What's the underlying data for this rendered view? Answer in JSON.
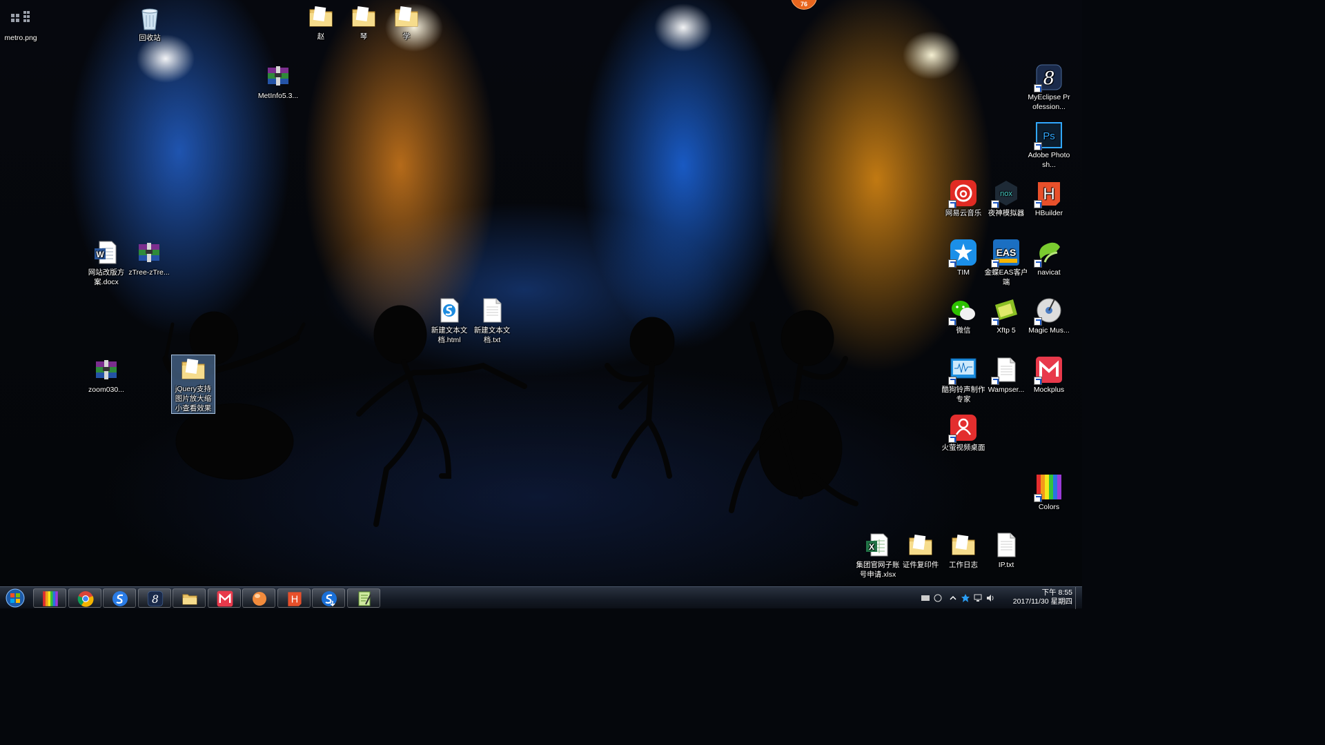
{
  "notification_badge": "76",
  "desktop_icons": [
    {
      "id": "metro-png",
      "label": "metro.png",
      "icon": "image-file-icon"
    },
    {
      "id": "recycle-bin",
      "label": "回收站",
      "icon": "recycle-bin-icon"
    },
    {
      "id": "folder-zhao",
      "label": "赵",
      "icon": "folder-icon"
    },
    {
      "id": "folder-qin",
      "label": "琴",
      "icon": "folder-icon"
    },
    {
      "id": "folder-xue",
      "label": "学",
      "icon": "folder-icon"
    },
    {
      "id": "metinfo",
      "label": "MetInfo5.3...",
      "icon": "winrar-archive-icon"
    },
    {
      "id": "website-docx",
      "label": "网站改版方案.docx",
      "icon": "word-document-icon"
    },
    {
      "id": "ztree",
      "label": "zTree-zTre...",
      "icon": "winrar-archive-icon"
    },
    {
      "id": "zoom030",
      "label": "zoom030...",
      "icon": "winrar-archive-icon"
    },
    {
      "id": "jquery-folder",
      "label": "jQuery支持图片放大缩小查看效果",
      "icon": "folder-icon"
    },
    {
      "id": "new-html",
      "label": "新建文本文档.html",
      "icon": "html-file-icon"
    },
    {
      "id": "new-txt",
      "label": "新建文本文档.txt",
      "icon": "text-file-icon"
    },
    {
      "id": "myeclipse",
      "label": "MyEclipse Profession...",
      "icon": "myeclipse-icon"
    },
    {
      "id": "photoshop",
      "label": "Adobe Photosh...",
      "icon": "photoshop-icon"
    },
    {
      "id": "netease-music",
      "label": "网易云音乐",
      "icon": "netease-music-icon"
    },
    {
      "id": "nox",
      "label": "夜神模拟器",
      "icon": "nox-emulator-icon"
    },
    {
      "id": "hbuilder",
      "label": "HBuilder",
      "icon": "hbuilder-icon"
    },
    {
      "id": "tim",
      "label": "TIM",
      "icon": "tim-icon"
    },
    {
      "id": "kingdee-eas",
      "label": "金蝶EAS客户端",
      "icon": "kingdee-eas-icon"
    },
    {
      "id": "navicat",
      "label": "navicat",
      "icon": "navicat-icon"
    },
    {
      "id": "wechat",
      "label": "微信",
      "icon": "wechat-icon"
    },
    {
      "id": "xftp",
      "label": "Xftp 5",
      "icon": "xftp-icon"
    },
    {
      "id": "magic-music",
      "label": "Magic Mus...",
      "icon": "magic-music-icon"
    },
    {
      "id": "kugou-ringtone",
      "label": "酷狗铃声制作专家",
      "icon": "kugou-ringtone-icon"
    },
    {
      "id": "wampserver",
      "label": "Wampser...",
      "icon": "text-file-icon"
    },
    {
      "id": "mockplus",
      "label": "Mockplus",
      "icon": "mockplus-icon"
    },
    {
      "id": "firefly-video",
      "label": "火萤视频桌面",
      "icon": "firefly-video-icon"
    },
    {
      "id": "colors",
      "label": "Colors",
      "icon": "colors-icon"
    },
    {
      "id": "group-xlsx",
      "label": "集团官网子账号申请.xlsx",
      "icon": "excel-document-icon"
    },
    {
      "id": "id-copy",
      "label": "证件复印件",
      "icon": "folder-icon"
    },
    {
      "id": "work-log",
      "label": "工作日志",
      "icon": "folder-icon"
    },
    {
      "id": "ip-txt",
      "label": "IP.txt",
      "icon": "text-file-icon"
    }
  ],
  "taskbar": {
    "start": "windows-start-icon",
    "pinned": [
      {
        "name": "colors-app",
        "icon": "colors-icon"
      },
      {
        "name": "chrome",
        "icon": "chrome-icon"
      },
      {
        "name": "sogou-browser",
        "icon": "sogou-browser-icon"
      },
      {
        "name": "myeclipse",
        "icon": "myeclipse-icon"
      },
      {
        "name": "file-explorer",
        "icon": "file-explorer-icon"
      },
      {
        "name": "mockplus",
        "icon": "mockplus-icon"
      },
      {
        "name": "firefly",
        "icon": "orange-ball-icon"
      },
      {
        "name": "hbuilder",
        "icon": "hbuilder-icon"
      },
      {
        "name": "sogou-input",
        "icon": "sogou-download-icon"
      },
      {
        "name": "notepad-plus",
        "icon": "notepad-plus-icon"
      }
    ],
    "clock": {
      "time": "下午 8:55",
      "date": "2017/11/30 星期四"
    }
  },
  "colors": {
    "taskbar": "#141a24",
    "badge": "#e8661e",
    "selection": "#78aae6"
  }
}
